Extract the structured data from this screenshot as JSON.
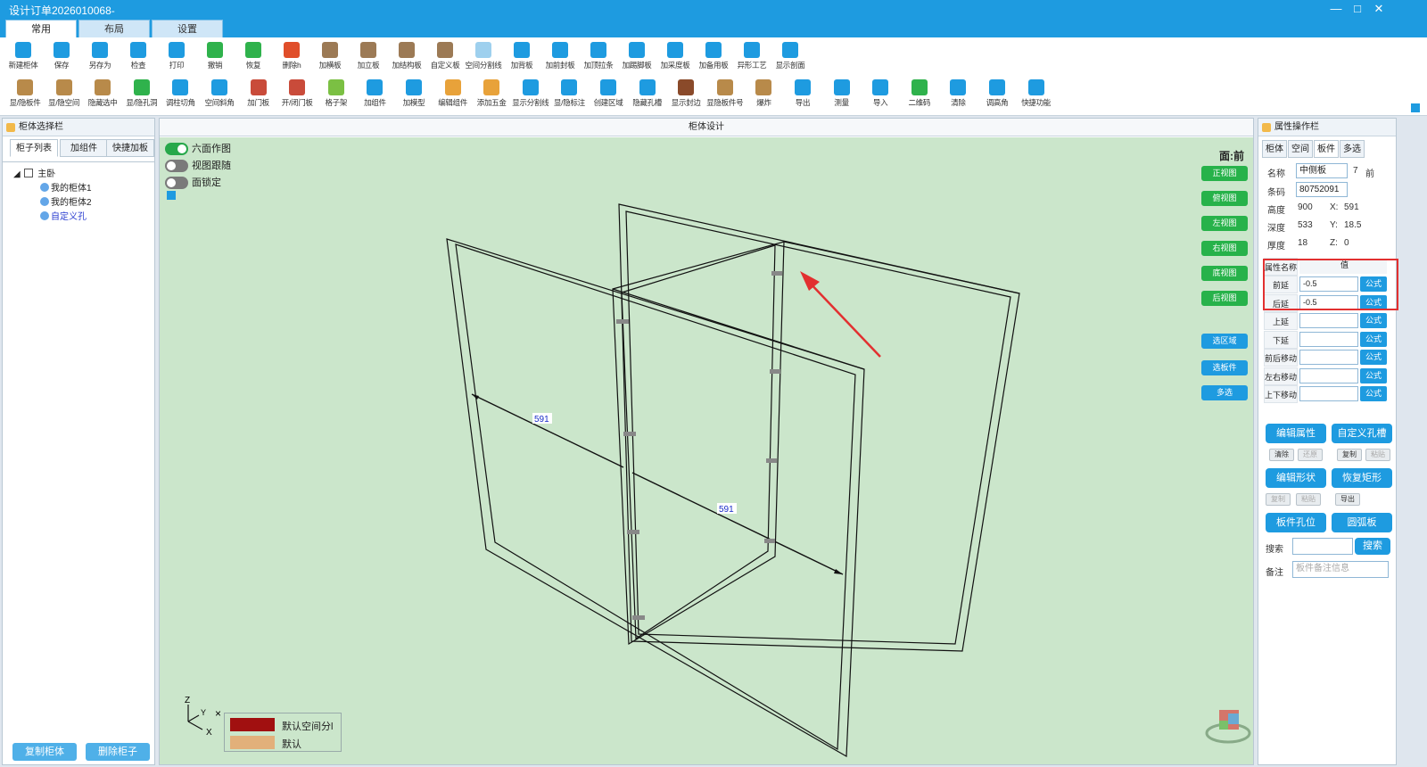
{
  "window": {
    "title": "设计订单2026010068-",
    "min": "—",
    "max": "□",
    "close": "✕"
  },
  "ribbon_tabs": [
    "常用",
    "布局",
    "设置"
  ],
  "toolbar_row1": [
    {
      "label": "新建柜体",
      "color": "#1e9be0"
    },
    {
      "label": "保存",
      "color": "#1e9be0"
    },
    {
      "label": "另存为",
      "color": "#1e9be0"
    },
    {
      "label": "检查",
      "color": "#1e9be0"
    },
    {
      "label": "打印",
      "color": "#1e9be0"
    },
    {
      "label": "撤销",
      "color": "#2fb24c"
    },
    {
      "label": "恢复",
      "color": "#2fb24c"
    },
    {
      "label": "删除h",
      "color": "#e04e2a"
    },
    {
      "label": "加横板",
      "color": "#9c7a55"
    },
    {
      "label": "加立板",
      "color": "#9c7a55"
    },
    {
      "label": "加结构板",
      "color": "#9c7a55"
    },
    {
      "label": "自定义板",
      "color": "#9c7a55"
    },
    {
      "label": "空间分割线",
      "color": "#9ed0ee"
    },
    {
      "label": "加背板",
      "color": "#1e9be0"
    },
    {
      "label": "加前封板",
      "color": "#1e9be0"
    },
    {
      "label": "加顶拉条",
      "color": "#1e9be0"
    },
    {
      "label": "加踢脚板",
      "color": "#1e9be0"
    },
    {
      "label": "加采度板",
      "color": "#1e9be0"
    },
    {
      "label": "加备用板",
      "color": "#1e9be0"
    },
    {
      "label": "异形工艺",
      "color": "#1e9be0"
    },
    {
      "label": "显示剖面",
      "color": "#1e9be0"
    }
  ],
  "toolbar_row2": [
    {
      "label": "显/隐板件",
      "color": "#b88a4a"
    },
    {
      "label": "显/隐空间",
      "color": "#b88a4a"
    },
    {
      "label": "隐藏选中",
      "color": "#b88a4a"
    },
    {
      "label": "显/隐孔洞",
      "color": "#2fb24c"
    },
    {
      "label": "调柱切角",
      "color": "#1e9be0"
    },
    {
      "label": "空间斜角",
      "color": "#1e9be0"
    },
    {
      "label": "加门板",
      "color": "#c94b3a"
    },
    {
      "label": "开/闭门板",
      "color": "#c94b3a"
    },
    {
      "label": "格子架",
      "color": "#7bc043"
    },
    {
      "label": "加组件",
      "color": "#1e9be0"
    },
    {
      "label": "加模型",
      "color": "#1e9be0"
    },
    {
      "label": "编辑组件",
      "color": "#e8a23a"
    },
    {
      "label": "添加五金",
      "color": "#e8a23a"
    },
    {
      "label": "显示分割线",
      "color": "#1e9be0"
    },
    {
      "label": "显/隐标注",
      "color": "#1e9be0"
    },
    {
      "label": "创建区域",
      "color": "#1e9be0"
    },
    {
      "label": "隐藏孔槽",
      "color": "#1e9be0"
    },
    {
      "label": "显示封边",
      "color": "#8a4a2a"
    },
    {
      "label": "显隐板件号",
      "color": "#b88a4a"
    },
    {
      "label": "爆炸",
      "color": "#b88a4a"
    },
    {
      "label": "导出",
      "color": "#1e9be0"
    },
    {
      "label": "测量",
      "color": "#1e9be0"
    },
    {
      "label": "导入",
      "color": "#1e9be0"
    },
    {
      "label": "二维码",
      "color": "#2fb24c"
    },
    {
      "label": "清除",
      "color": "#1e9be0"
    },
    {
      "label": "调高角",
      "color": "#1e9be0"
    },
    {
      "label": "快捷功能",
      "color": "#1e9be0"
    }
  ],
  "left_panel": {
    "title": "柜体选择栏",
    "tabs": [
      "柜子列表",
      "加组件",
      "快捷加板"
    ],
    "tree": {
      "root": "主卧",
      "children": [
        "我的柜体1",
        "我的柜体2",
        "自定义孔"
      ]
    },
    "buttons": {
      "copy": "复制柜体",
      "delete": "删除柜子"
    }
  },
  "center": {
    "title": "柜体设计",
    "toggles": [
      {
        "label": "六面作图",
        "on": true
      },
      {
        "label": "视图跟随",
        "on": false
      },
      {
        "label": "面锁定",
        "on": false
      }
    ],
    "face_label": "面:前",
    "view_buttons": [
      "正视图",
      "俯视图",
      "左视图",
      "右视图",
      "底视图",
      "后视图"
    ],
    "select_buttons": [
      "选区域",
      "选板件",
      "多选"
    ],
    "dimensions": [
      "591",
      "591"
    ],
    "axes": {
      "z": "Z",
      "y": "Y",
      "x": "X",
      "close": "×"
    },
    "legend": [
      {
        "label": "默认空间分l",
        "color": "#a11010"
      },
      {
        "label": "默认",
        "color": "#e2b07a"
      }
    ]
  },
  "right_panel": {
    "title": "属性操作栏",
    "tabs": [
      "柜体",
      "空间",
      "板件",
      "多选"
    ],
    "active_tab": "板件",
    "fields": {
      "name_label": "名称",
      "name_value": "中侧板",
      "name_num": "7",
      "name_face": "前",
      "code_label": "条码",
      "code_value": "80752091",
      "height_label": "高度",
      "height_value": "900",
      "x_label": "X:",
      "x_value": "591",
      "depth_label": "深度",
      "depth_value": "533",
      "y_label": "Y:",
      "y_value": "18.5",
      "thick_label": "厚度",
      "thick_value": "18",
      "z_label": "Z:",
      "z_value": "0"
    },
    "prop_header": {
      "name": "属性名称",
      "value": "值"
    },
    "props": [
      {
        "name": "前延",
        "value": "-0.5",
        "btn": "公式"
      },
      {
        "name": "后延",
        "value": "-0.5",
        "btn": "公式"
      },
      {
        "name": "上延",
        "value": "",
        "btn": "公式"
      },
      {
        "name": "下延",
        "value": "",
        "btn": "公式"
      },
      {
        "name": "前后移动",
        "value": "",
        "btn": "公式"
      },
      {
        "name": "左右移动",
        "value": "",
        "btn": "公式"
      },
      {
        "name": "上下移动",
        "value": "",
        "btn": "公式"
      }
    ],
    "buttons": {
      "edit_props": "编辑属性",
      "custom_hole": "自定义孔槽",
      "clear": "清除",
      "restore": "还原",
      "copy": "复制",
      "paste": "粘贴",
      "edit_shape": "编辑形状",
      "restore_rect": "恢复矩形",
      "copy2": "复制",
      "paste2": "粘贴",
      "export": "导出",
      "hole_pos": "板件孔位",
      "arc_board": "圆弧板",
      "search_label": "搜索",
      "search_btn": "搜索",
      "note_label": "备注",
      "note_placeholder": "板件备注信息"
    }
  }
}
